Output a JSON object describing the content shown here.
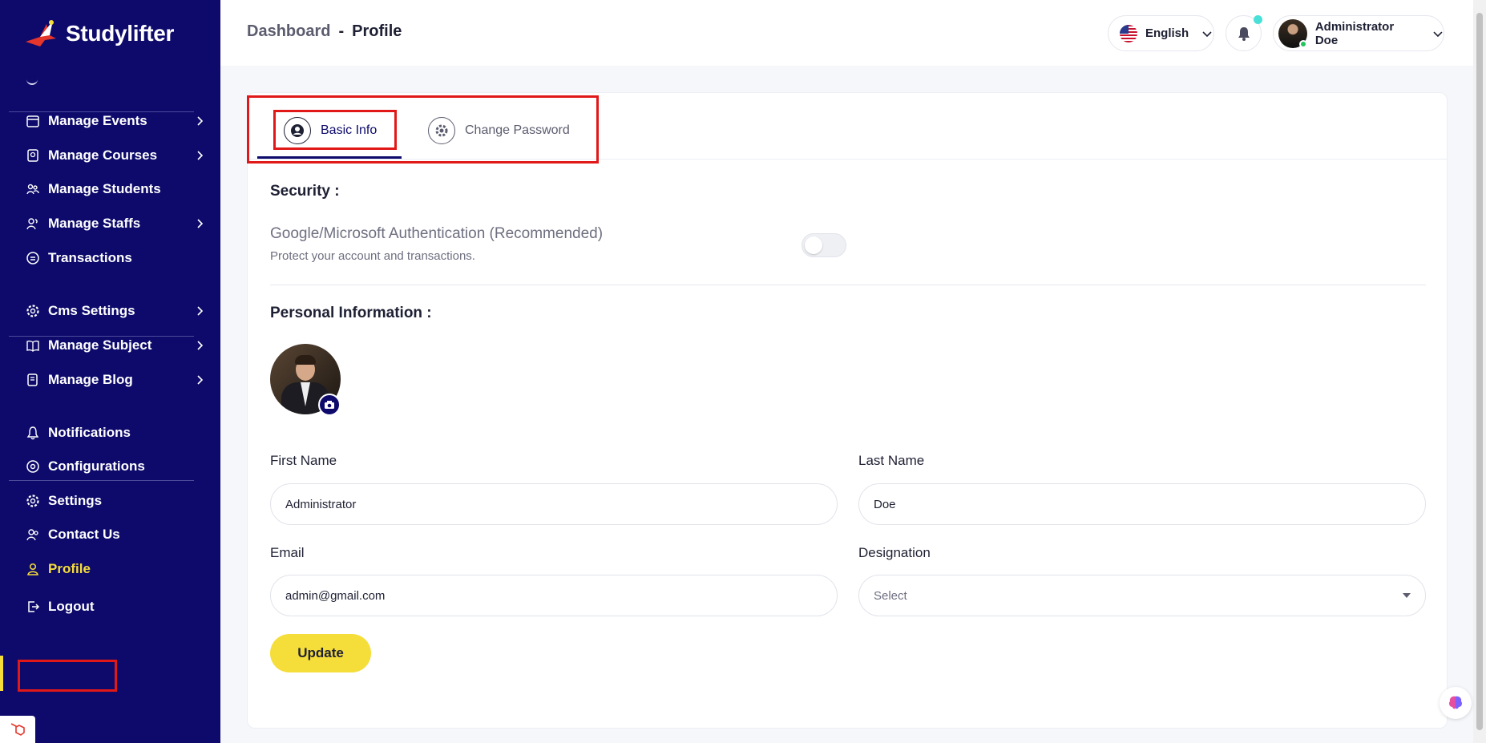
{
  "app": {
    "name": "Studylifter"
  },
  "sidebar": {
    "groups": [
      [
        {
          "label": "Manage Events",
          "icon": "calendar-icon",
          "chevron": true
        },
        {
          "label": "Manage Courses",
          "icon": "courses-icon",
          "chevron": true
        },
        {
          "label": "Manage Students",
          "icon": "students-icon",
          "chevron": false
        },
        {
          "label": "Manage Staffs",
          "icon": "staffs-icon",
          "chevron": true
        },
        {
          "label": "Transactions",
          "icon": "transactions-icon",
          "chevron": false
        }
      ],
      [
        {
          "label": "Cms Settings",
          "icon": "cms-settings-icon",
          "chevron": true
        },
        {
          "label": "Manage Subject",
          "icon": "book-icon",
          "chevron": true
        },
        {
          "label": "Manage Blog",
          "icon": "blog-icon",
          "chevron": true
        }
      ],
      [
        {
          "label": "Notifications",
          "icon": "bell-icon",
          "chevron": false
        },
        {
          "label": "Configurations",
          "icon": "configurations-icon",
          "chevron": false
        },
        {
          "label": "Settings",
          "icon": "gear-icon",
          "chevron": false
        },
        {
          "label": "Contact Us",
          "icon": "contact-icon",
          "chevron": false
        },
        {
          "label": "Profile",
          "icon": "user-icon",
          "chevron": false,
          "active": true
        },
        {
          "label": "Logout",
          "icon": "logout-icon",
          "chevron": false
        }
      ]
    ],
    "active_color": "#f5dd3a",
    "background": "#0d0a6b"
  },
  "header": {
    "breadcrumb": {
      "parent": "Dashboard",
      "separator": "-",
      "current": "Profile"
    },
    "language": "English",
    "user_name": "Administrator Doe"
  },
  "tabs": [
    {
      "label": "Basic Info",
      "icon": "user-circle-icon",
      "active": true
    },
    {
      "label": "Change Password",
      "icon": "gear-icon",
      "active": false
    }
  ],
  "security": {
    "title": "Security :",
    "auth_title": "Google/Microsoft Authentication (Recommended)",
    "auth_subtitle": "Protect your account and transactions.",
    "enabled": false
  },
  "personal": {
    "title": "Personal Information :",
    "first_name_label": "First Name",
    "first_name": "Administrator",
    "last_name_label": "Last Name",
    "last_name": "Doe",
    "email_label": "Email",
    "email": "admin@gmail.com",
    "designation_label": "Designation",
    "designation": "Select"
  },
  "update_label": "Update"
}
